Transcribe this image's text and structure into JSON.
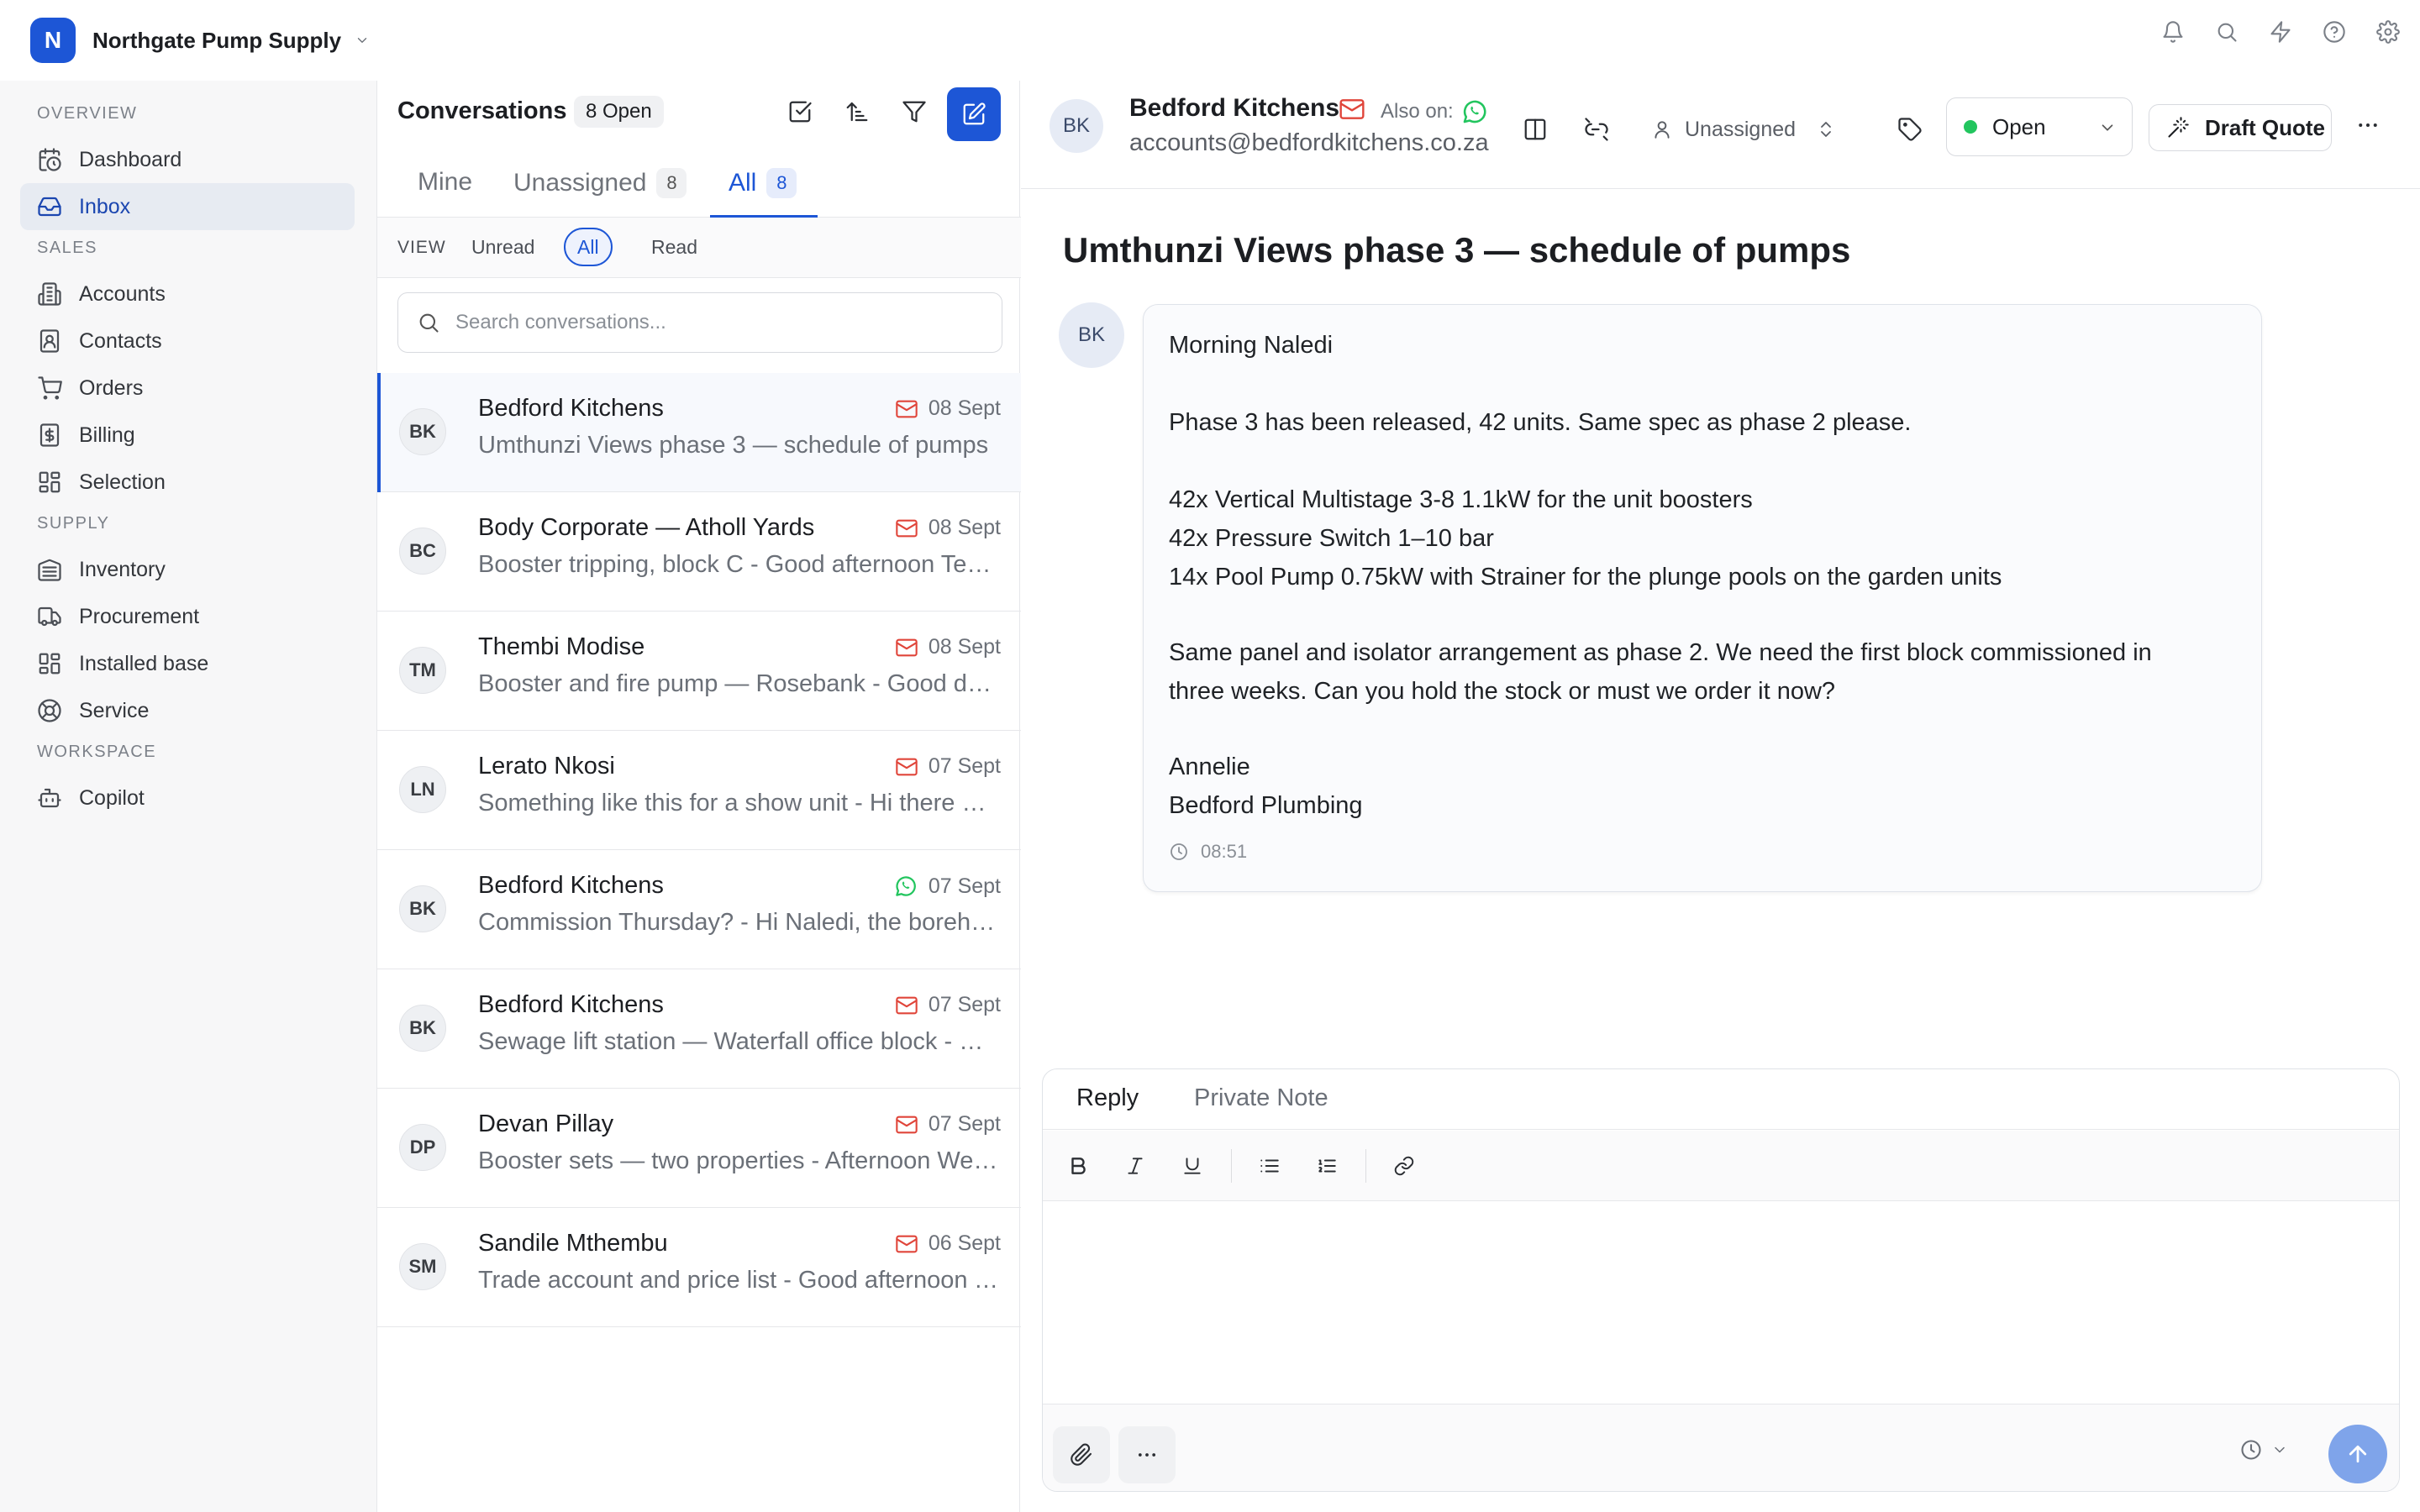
{
  "workspace": {
    "badge": "N",
    "name": "Northgate Pump Supply"
  },
  "topbar": {
    "icons": [
      "bell-icon",
      "search-icon",
      "lightning-icon",
      "help-icon",
      "settings-icon"
    ]
  },
  "sidebar": {
    "sections": [
      {
        "label": "OVERVIEW",
        "items": [
          {
            "label": "Dashboard",
            "icon": "calendar-clock-icon"
          },
          {
            "label": "Inbox",
            "icon": "inbox-icon",
            "active": true
          }
        ]
      },
      {
        "label": "SALES",
        "items": [
          {
            "label": "Accounts",
            "icon": "building-icon"
          },
          {
            "label": "Contacts",
            "icon": "contact-card-icon"
          },
          {
            "label": "Orders",
            "icon": "cart-icon"
          },
          {
            "label": "Billing",
            "icon": "dollar-doc-icon"
          },
          {
            "label": "Selection",
            "icon": "grid-icon"
          }
        ]
      },
      {
        "label": "SUPPLY",
        "items": [
          {
            "label": "Inventory",
            "icon": "warehouse-icon"
          },
          {
            "label": "Procurement",
            "icon": "truck-icon"
          },
          {
            "label": "Installed base",
            "icon": "grid-icon"
          },
          {
            "label": "Service",
            "icon": "lifebuoy-icon"
          }
        ]
      },
      {
        "label": "WORKSPACE",
        "items": [
          {
            "label": "Copilot",
            "icon": "bot-icon"
          }
        ]
      }
    ]
  },
  "list": {
    "title": "Conversations",
    "open_badge": "8 Open",
    "tabs": [
      {
        "label": "Mine",
        "count": ""
      },
      {
        "label": "Unassigned",
        "count": "8"
      },
      {
        "label": "All",
        "count": "8",
        "active": true
      }
    ],
    "view": {
      "label": "VIEW",
      "options": [
        "Unread",
        "All",
        "Read"
      ],
      "selected": "All"
    },
    "search_placeholder": "Search conversations...",
    "conversations": [
      {
        "initials": "BK",
        "name": "Bedford Kitchens",
        "preview": "Umthunzi Views phase 3 — schedule of pumps",
        "date": "08 Sept",
        "channel": "email",
        "selected": true
      },
      {
        "initials": "BC",
        "name": "Body Corporate — Atholl Yards",
        "preview": "Booster tripping, block C - Good afternoon Team",
        "date": "08 Sept",
        "channel": "email"
      },
      {
        "initials": "TM",
        "name": "Thembi Modise",
        "preview": "Booster and fire pump — Rosebank - Good day Naledi",
        "date": "08 Sept",
        "channel": "email"
      },
      {
        "initials": "LN",
        "name": "Lerato Nkosi",
        "preview": "Something like this for a show unit - Hi there Naledi",
        "date": "07 Sept",
        "channel": "email"
      },
      {
        "initials": "BK",
        "name": "Bedford Kitchens",
        "preview": "Commission Thursday? - Hi Naledi, the borehole",
        "date": "07 Sept",
        "channel": "whatsapp"
      },
      {
        "initials": "BK",
        "name": "Bedford Kitchens",
        "preview": "Sewage lift station — Waterfall office block - Morning",
        "date": "07 Sept",
        "channel": "email"
      },
      {
        "initials": "DP",
        "name": "Devan Pillay",
        "preview": "Booster sets — two properties - Afternoon Wendy",
        "date": "07 Sept",
        "channel": "email"
      },
      {
        "initials": "SM",
        "name": "Sandile Mthembu",
        "preview": "Trade account and price list - Good afternoon Team",
        "date": "06 Sept",
        "channel": "email"
      }
    ]
  },
  "conversation": {
    "contact": {
      "initials": "BK",
      "name": "Bedford Kitchens",
      "email": "accounts@bedfordkitchens.co.za",
      "also_on_label": "Also on:"
    },
    "assignee": "Unassigned",
    "status": "Open",
    "draft_label": "Draft Quote",
    "subject": "Umthunzi Views phase 3 — schedule of pumps",
    "message": {
      "lines": [
        "Morning Naledi",
        "Phase 3 has been released, 42 units. Same spec as phase 2 please.",
        "42x Vertical Multistage 3-8 1.1kW for the unit boosters",
        "42x Pressure Switch 1–10 bar",
        "14x Pool Pump 0.75kW with Strainer for the plunge pools on the garden units",
        "Same panel and isolator arrangement as phase 2. We need the first block commissioned in",
        "three weeks. Can you hold the stock or must we order it now?",
        "Annelie",
        "Bedford Plumbing"
      ],
      "time": "08:51"
    }
  },
  "composer": {
    "tabs": [
      "Reply",
      "Private Note"
    ],
    "active_tab": "Reply"
  },
  "colors": {
    "accent": "#1d56d6",
    "email": "#e0453a",
    "whatsapp": "#22c55e",
    "status_open": "#22c55e"
  }
}
